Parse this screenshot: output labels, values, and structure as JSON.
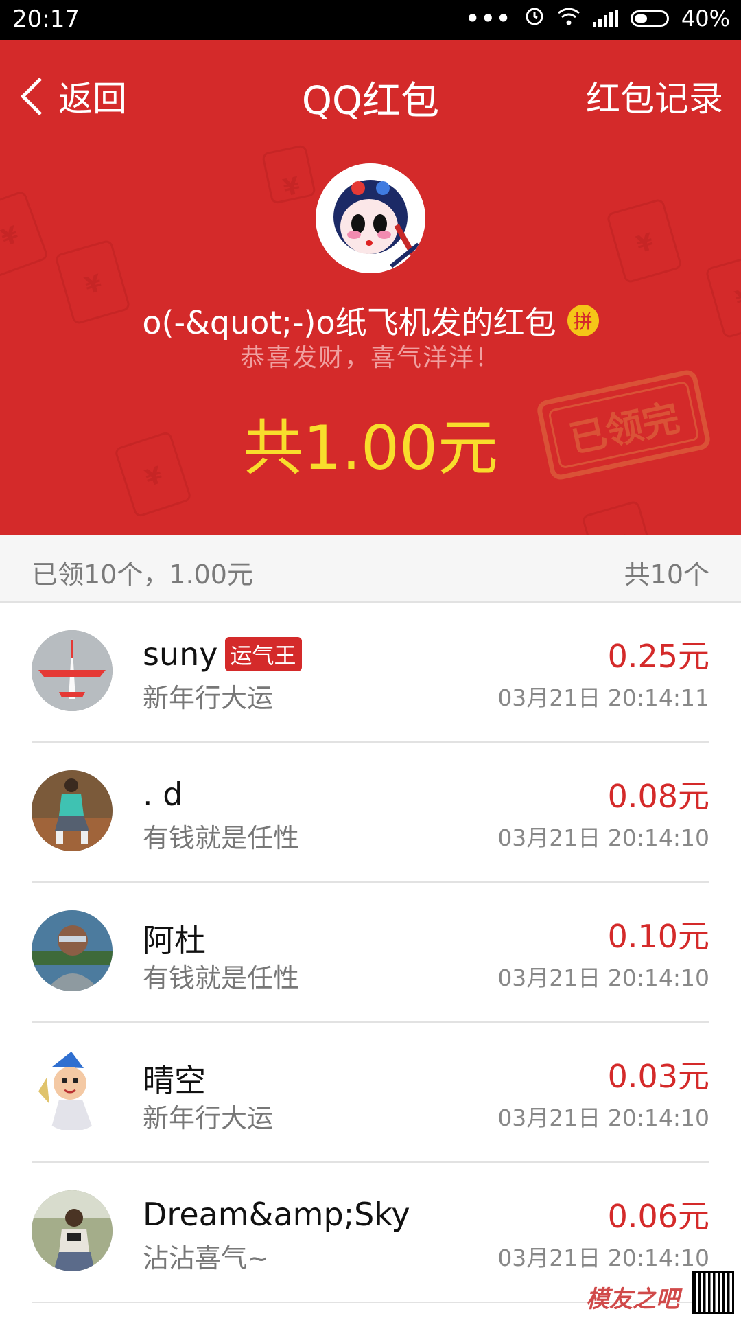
{
  "status_bar": {
    "time": "20:17",
    "dots": "•••",
    "battery_text": "40%"
  },
  "header": {
    "back_label": "返回",
    "title": "QQ红包",
    "records_label": "红包记录",
    "sender": "o(-&quot;-)o纸飞机发的红包",
    "pin_badge": "拼",
    "greeting": "恭喜发财，喜气洋洋！",
    "total": "共1.00元",
    "stamp": "已领完",
    "accent_color": "#d42a2a",
    "amount_color": "#f8dd2c"
  },
  "summary": {
    "left": "已领10个，1.00元",
    "right": "共10个"
  },
  "entries": [
    {
      "name": "suny",
      "badge": "运气王",
      "message": "新年行大运",
      "amount": "0.25元",
      "time": "03月21日 20:14:11"
    },
    {
      "name": ". d",
      "badge": "",
      "message": "有钱就是任性",
      "amount": "0.08元",
      "time": "03月21日 20:14:10"
    },
    {
      "name": "阿杜",
      "badge": "",
      "message": "有钱就是任性",
      "amount": "0.10元",
      "time": "03月21日 20:14:10"
    },
    {
      "name": "晴空",
      "badge": "",
      "message": "新年行大运",
      "amount": "0.03元",
      "time": "03月21日 20:14:10"
    },
    {
      "name": "Dream&amp;Sky",
      "badge": "",
      "message": "沾沾喜气~",
      "amount": "0.06元",
      "time": "03月21日 20:14:10"
    }
  ],
  "watermark": {
    "text": "模友之吧"
  }
}
